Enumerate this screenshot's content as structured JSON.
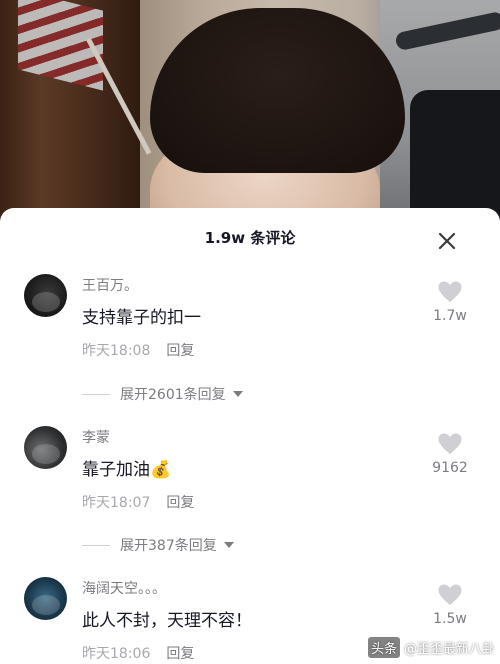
{
  "sheet": {
    "title": "1.9w 条评论"
  },
  "comments": [
    {
      "username": "王百万。",
      "text": "支持靠子的扣一",
      "time": "昨天18:08",
      "reply_label": "回复",
      "likes": "1.7w",
      "expand_label": "展开2601条回复"
    },
    {
      "username": "李蒙",
      "text": "靠子加油💰",
      "time": "昨天18:07",
      "reply_label": "回复",
      "likes": "9162",
      "expand_label": "展开387条回复"
    },
    {
      "username": "海阔天空。。。",
      "text": "此人不封，天理不容！",
      "time": "昨天18:06",
      "reply_label": "回复",
      "likes": "1.5w"
    }
  ],
  "watermark": {
    "source": "头条",
    "account": "@歪歪最新八卦"
  },
  "colors": {
    "text_primary": "#161823",
    "text_secondary": "#7b7c80",
    "text_tertiary": "#a8a9ad",
    "like_icon": "#d0d0d4"
  },
  "icons": {
    "close": "close-icon",
    "like": "heart-icon",
    "expand": "caret-down-icon"
  }
}
